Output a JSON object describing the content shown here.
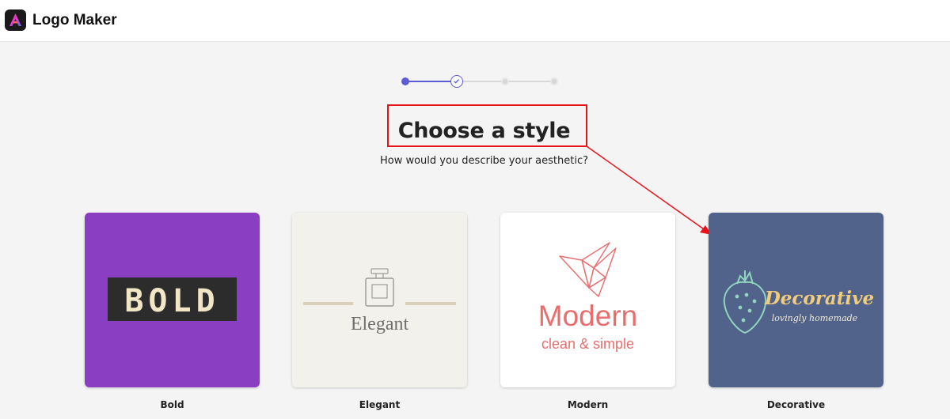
{
  "app": {
    "title": "Logo Maker"
  },
  "stepper": {
    "current_step": 2,
    "total_steps": 4,
    "accent_color": "#5b5bd6"
  },
  "heading": {
    "title": "Choose a style",
    "subtitle": "How would you describe your aesthetic?"
  },
  "styles": [
    {
      "label": "Bold",
      "preview_text": "BOLD",
      "background": "#8a3fc2"
    },
    {
      "label": "Elegant",
      "preview_text": "Elegant",
      "background": "#f2f1ec"
    },
    {
      "label": "Modern",
      "preview_text": "Modern",
      "preview_subtext": "clean & simple",
      "background": "#ffffff"
    },
    {
      "label": "Decorative",
      "preview_text": "Decorative",
      "preview_subtext": "lovingly homemade",
      "background": "#51628b"
    }
  ],
  "annotation": {
    "color": "#e8141a"
  }
}
